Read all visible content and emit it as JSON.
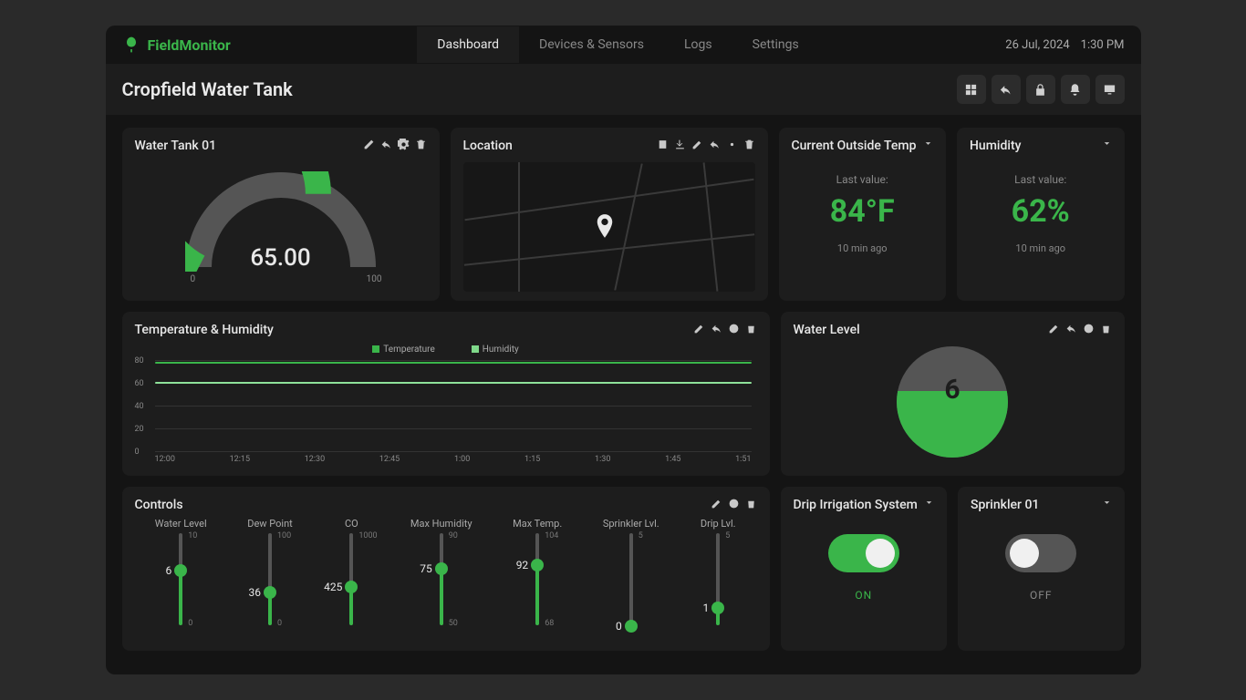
{
  "brand": "FieldMonitor",
  "nav": {
    "tabs": [
      "Dashboard",
      "Devices & Sensors",
      "Logs",
      "Settings"
    ],
    "active": 0
  },
  "date": "26 Jul, 2024",
  "time": "1:30 PM",
  "page_title": "Cropfield Water Tank",
  "gauge": {
    "title": "Water Tank 01",
    "value": "65.00",
    "min": "0",
    "max": "100",
    "pct": 65
  },
  "location": {
    "title": "Location"
  },
  "stats": [
    {
      "title": "Current Outside Temp",
      "sub": "Last value:",
      "value": "84°F",
      "time": "10 min ago"
    },
    {
      "title": "Humidity",
      "sub": "Last value:",
      "value": "62%",
      "time": "10 min ago"
    }
  ],
  "chart_title": "Temperature & Humidity",
  "chart_data": {
    "type": "line",
    "x": [
      "12:00",
      "12:15",
      "12:30",
      "12:45",
      "1:00",
      "1:15",
      "1:30",
      "1:45",
      "1:51"
    ],
    "ylim": [
      0,
      80
    ],
    "yticks": [
      0,
      20,
      40,
      60,
      80
    ],
    "series": [
      {
        "name": "Temperature",
        "values": [
          78,
          78,
          78,
          78,
          79,
          79,
          79,
          79,
          79
        ]
      },
      {
        "name": "Humidity",
        "values": [
          60,
          60,
          60,
          60,
          61,
          62,
          62,
          62,
          62
        ]
      }
    ]
  },
  "water_level": {
    "title": "Water Level",
    "value": "6",
    "pct": 60
  },
  "controls": {
    "title": "Controls",
    "sliders": [
      {
        "name": "Water Level",
        "value": "6",
        "min": "0",
        "max": "10",
        "pct": 60
      },
      {
        "name": "Dew Point",
        "value": "36",
        "min": "0",
        "max": "100",
        "pct": 36
      },
      {
        "name": "CO",
        "value": "425",
        "min": "",
        "max": "1000",
        "pct": 42
      },
      {
        "name": "Max Humidity",
        "value": "75",
        "min": "50",
        "max": "90",
        "pct": 62
      },
      {
        "name": "Max Temp.",
        "value": "92",
        "min": "68",
        "max": "104",
        "pct": 66
      },
      {
        "name": "Sprinkler Lvl.",
        "value": "0",
        "min": "",
        "max": "5",
        "pct": 0
      },
      {
        "name": "Drip Lvl.",
        "value": "1",
        "min": "",
        "max": "5",
        "pct": 20
      }
    ]
  },
  "toggles": [
    {
      "title": "Drip Irrigation System",
      "state": "ON"
    },
    {
      "title": "Sprinkler 01",
      "state": "OFF"
    }
  ]
}
